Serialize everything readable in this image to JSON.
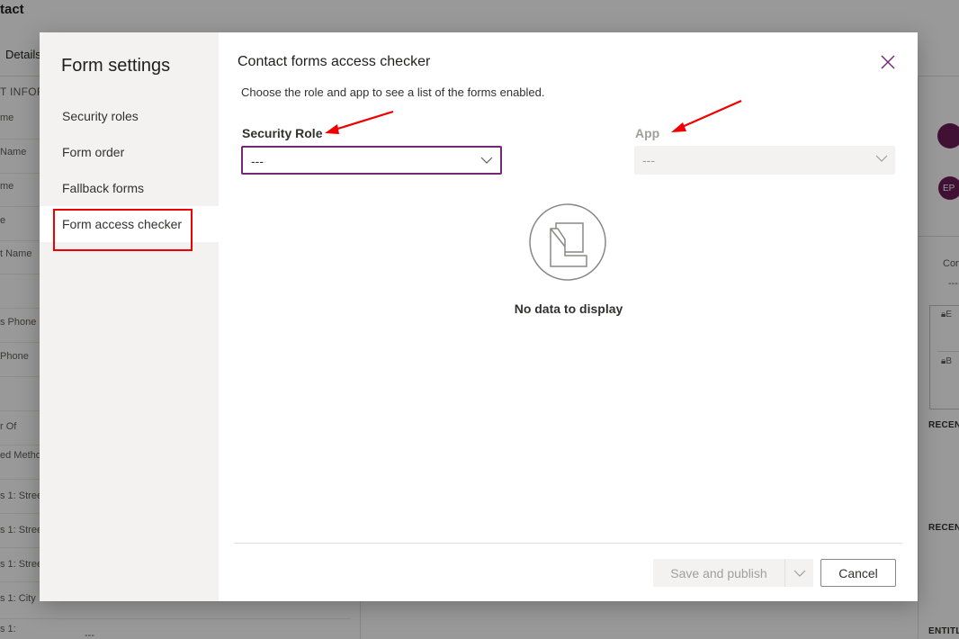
{
  "background": {
    "title": "tact",
    "tab": "Details",
    "section": "T INFOR",
    "fields": [
      "me",
      "Name",
      "me",
      "e",
      "t Name",
      "s Phone",
      "Phone",
      "r Of",
      "ed Method",
      "s 1: Street",
      "s 1: Street",
      "s 1: Street",
      "s 1: City",
      "s 1:"
    ],
    "bottom_value": "---",
    "avatar_initials": "EP",
    "right_label": "Con",
    "right_value": "---",
    "right_lock_1": "E",
    "right_lock_2": "B",
    "recent_1": "RECENT",
    "recent_2": "RECENT",
    "entitlements": "ENTITL"
  },
  "dialog": {
    "sidebar": {
      "title": "Form settings",
      "items": [
        {
          "label": "Security roles",
          "selected": false
        },
        {
          "label": "Form order",
          "selected": false
        },
        {
          "label": "Fallback forms",
          "selected": false
        },
        {
          "label": "Form access checker",
          "selected": true
        }
      ]
    },
    "title": "Contact forms access checker",
    "description": "Choose the role and app to see a list of the forms enabled.",
    "security_role": {
      "label": "Security Role",
      "value": "---"
    },
    "app": {
      "label": "App",
      "value": "---",
      "disabled": true
    },
    "empty_state": {
      "text": "No data to display",
      "icon": "empty-folder-icon"
    },
    "footer": {
      "save_label": "Save and publish",
      "save_disabled": true,
      "cancel_label": "Cancel"
    }
  },
  "colors": {
    "accent": "#742774",
    "annotation": "#e00000",
    "overlay": "rgba(0,0,0,0.4)"
  }
}
